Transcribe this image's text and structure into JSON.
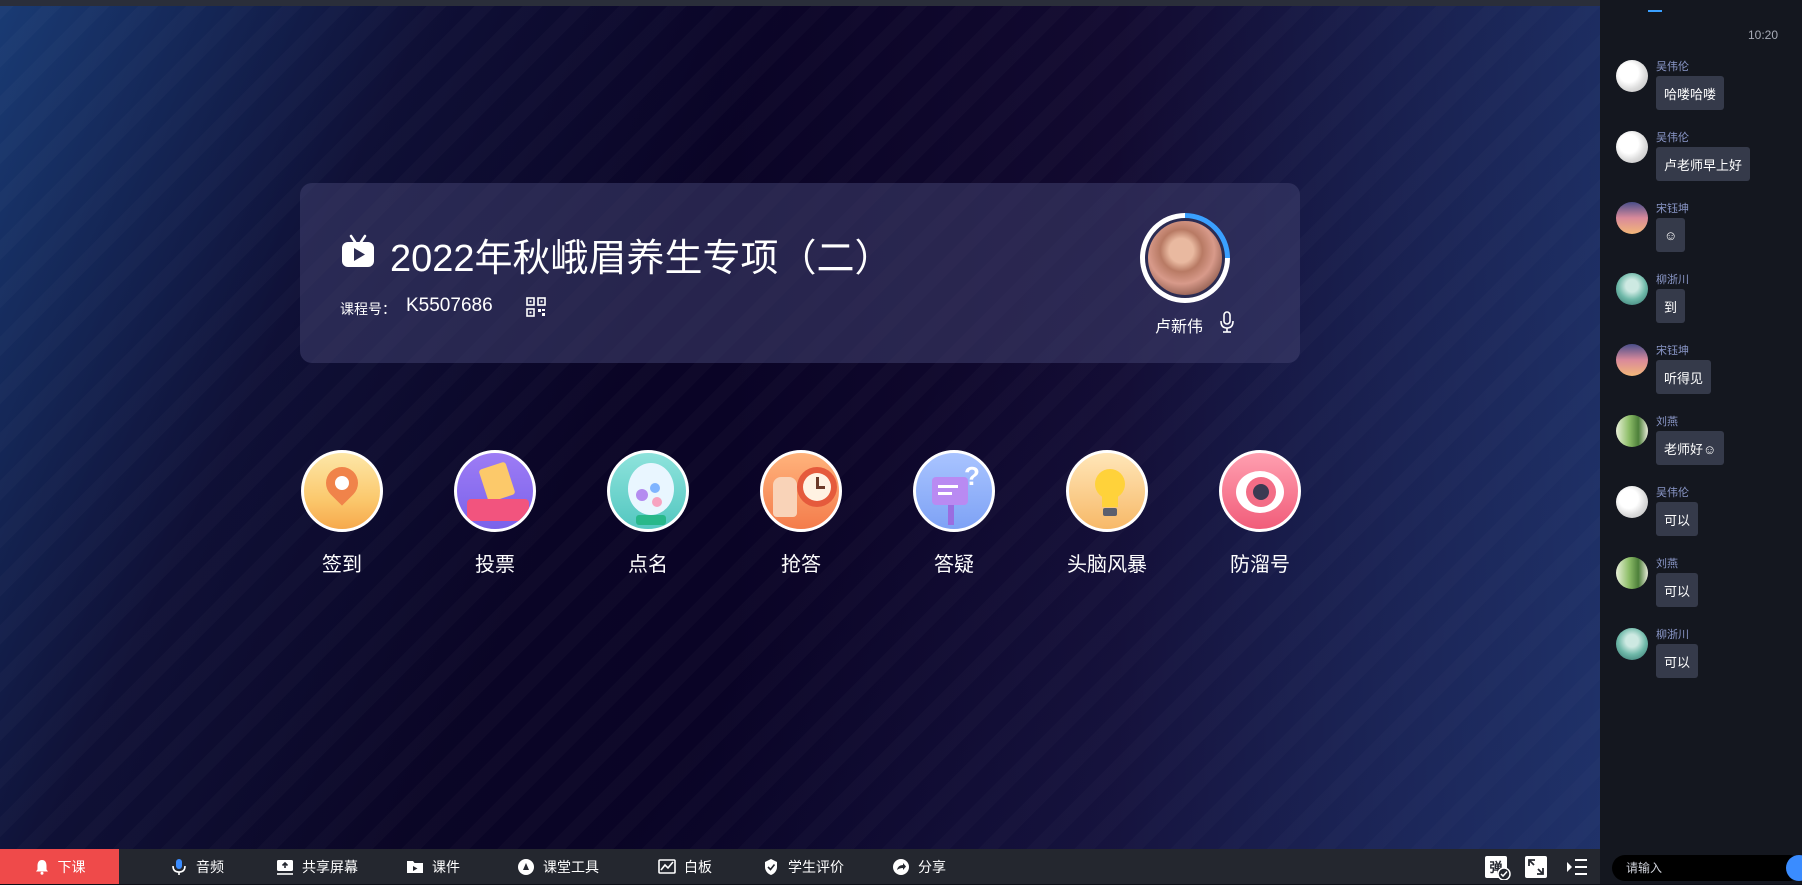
{
  "course": {
    "title": "2022年秋峨眉养生专项（二）",
    "code_label": "课程号：",
    "code_value": "K5507686",
    "teacher_name": "卢新伟"
  },
  "tools": [
    {
      "label": "签到",
      "icon": "map-pin-icon"
    },
    {
      "label": "投票",
      "icon": "ballot-icon"
    },
    {
      "label": "点名",
      "icon": "lottery-ball-icon"
    },
    {
      "label": "抢答",
      "icon": "alarm-clock-icon"
    },
    {
      "label": "答疑",
      "icon": "question-mailbox-icon"
    },
    {
      "label": "头脑风暴",
      "icon": "lightbulb-icon"
    },
    {
      "label": "防溜号",
      "icon": "eye-icon"
    }
  ],
  "toolbar": {
    "end_class": "下课",
    "audio": "音频",
    "share_screen": "共享屏幕",
    "courseware": "课件",
    "classroom_tools": "课堂工具",
    "whiteboard": "白板",
    "student_review": "学生评价",
    "share": "分享",
    "danmaku_icon_text": "弹"
  },
  "chat": {
    "time": "10:20",
    "messages": [
      {
        "name": "吴伟伦",
        "text": "哈喽哈喽"
      },
      {
        "name": "吴伟伦",
        "text": "卢老师早上好"
      },
      {
        "name": "宋钰坤",
        "text": "☺"
      },
      {
        "name": "柳浙川",
        "text": "到"
      },
      {
        "name": "宋钰坤",
        "text": "听得见"
      },
      {
        "name": "刘燕",
        "text": "老师好☺"
      },
      {
        "name": "吴伟伦",
        "text": "可以"
      },
      {
        "name": "刘燕",
        "text": "可以"
      },
      {
        "name": "柳浙川",
        "text": "可以"
      }
    ],
    "input_placeholder": "请输入"
  },
  "colors": {
    "end_class_bg": "#ef4a4a",
    "accent": "#3a8cff",
    "bubble_bg": "#353a4a",
    "name_color": "#8b98c9"
  }
}
